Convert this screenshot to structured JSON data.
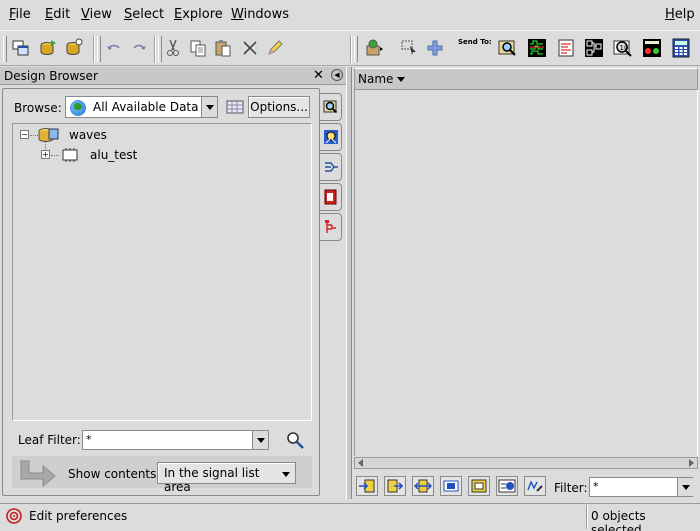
{
  "menu": {
    "items": [
      {
        "label": "File",
        "u": "F",
        "rest": "ile"
      },
      {
        "label": "Edit",
        "u": "E",
        "rest": "dit"
      },
      {
        "label": "View",
        "u": "V",
        "rest": "iew"
      },
      {
        "label": "Select",
        "u": "S",
        "rest": "elect"
      },
      {
        "label": "Explore",
        "u": "E",
        "rest": "xplore"
      },
      {
        "label": "Windows",
        "u": "W",
        "rest": "indows"
      },
      {
        "label": "Help",
        "u": "H",
        "rest": "elp"
      }
    ]
  },
  "toolbar": {
    "send_to_label": "Send To:"
  },
  "design_browser": {
    "title": "Design Browser",
    "close_glyph": "✕",
    "float_glyph": "◀",
    "browse_label": "Browse:",
    "browse_value": "All Available Data",
    "options_label": "Options...",
    "tree": {
      "root": {
        "label": "waves",
        "toggle": "−"
      },
      "child": {
        "label": "alu_test",
        "toggle": "+"
      }
    },
    "leaf_filter_label": "Leaf Filter:",
    "leaf_filter_value": "*",
    "show_contents_label": "Show contents:",
    "show_contents_value": "In the signal list area"
  },
  "signal_list": {
    "name_column": "Name",
    "filter_label": "Filter:",
    "filter_value": "*"
  },
  "status": {
    "message": "Edit preferences",
    "selection": "0 objects selected"
  },
  "colors": {
    "background": "#dcdcdc",
    "accent_blue": "#1a6fd0"
  }
}
